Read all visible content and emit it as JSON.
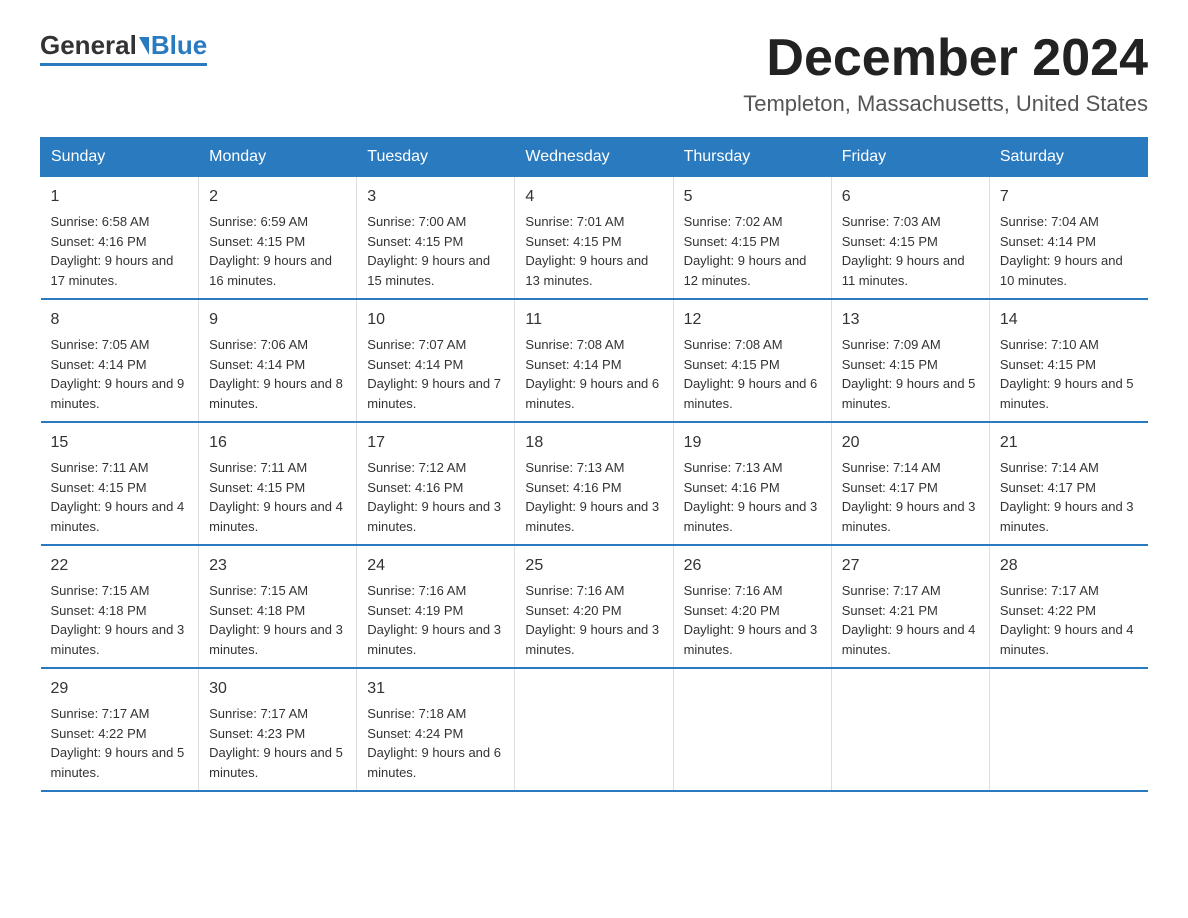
{
  "logo": {
    "general": "General",
    "blue": "Blue"
  },
  "title": "December 2024",
  "subtitle": "Templeton, Massachusetts, United States",
  "headers": [
    "Sunday",
    "Monday",
    "Tuesday",
    "Wednesday",
    "Thursday",
    "Friday",
    "Saturday"
  ],
  "weeks": [
    [
      {
        "day": "1",
        "sunrise": "6:58 AM",
        "sunset": "4:16 PM",
        "daylight": "9 hours and 17 minutes."
      },
      {
        "day": "2",
        "sunrise": "6:59 AM",
        "sunset": "4:15 PM",
        "daylight": "9 hours and 16 minutes."
      },
      {
        "day": "3",
        "sunrise": "7:00 AM",
        "sunset": "4:15 PM",
        "daylight": "9 hours and 15 minutes."
      },
      {
        "day": "4",
        "sunrise": "7:01 AM",
        "sunset": "4:15 PM",
        "daylight": "9 hours and 13 minutes."
      },
      {
        "day": "5",
        "sunrise": "7:02 AM",
        "sunset": "4:15 PM",
        "daylight": "9 hours and 12 minutes."
      },
      {
        "day": "6",
        "sunrise": "7:03 AM",
        "sunset": "4:15 PM",
        "daylight": "9 hours and 11 minutes."
      },
      {
        "day": "7",
        "sunrise": "7:04 AM",
        "sunset": "4:14 PM",
        "daylight": "9 hours and 10 minutes."
      }
    ],
    [
      {
        "day": "8",
        "sunrise": "7:05 AM",
        "sunset": "4:14 PM",
        "daylight": "9 hours and 9 minutes."
      },
      {
        "day": "9",
        "sunrise": "7:06 AM",
        "sunset": "4:14 PM",
        "daylight": "9 hours and 8 minutes."
      },
      {
        "day": "10",
        "sunrise": "7:07 AM",
        "sunset": "4:14 PM",
        "daylight": "9 hours and 7 minutes."
      },
      {
        "day": "11",
        "sunrise": "7:08 AM",
        "sunset": "4:14 PM",
        "daylight": "9 hours and 6 minutes."
      },
      {
        "day": "12",
        "sunrise": "7:08 AM",
        "sunset": "4:15 PM",
        "daylight": "9 hours and 6 minutes."
      },
      {
        "day": "13",
        "sunrise": "7:09 AM",
        "sunset": "4:15 PM",
        "daylight": "9 hours and 5 minutes."
      },
      {
        "day": "14",
        "sunrise": "7:10 AM",
        "sunset": "4:15 PM",
        "daylight": "9 hours and 5 minutes."
      }
    ],
    [
      {
        "day": "15",
        "sunrise": "7:11 AM",
        "sunset": "4:15 PM",
        "daylight": "9 hours and 4 minutes."
      },
      {
        "day": "16",
        "sunrise": "7:11 AM",
        "sunset": "4:15 PM",
        "daylight": "9 hours and 4 minutes."
      },
      {
        "day": "17",
        "sunrise": "7:12 AM",
        "sunset": "4:16 PM",
        "daylight": "9 hours and 3 minutes."
      },
      {
        "day": "18",
        "sunrise": "7:13 AM",
        "sunset": "4:16 PM",
        "daylight": "9 hours and 3 minutes."
      },
      {
        "day": "19",
        "sunrise": "7:13 AM",
        "sunset": "4:16 PM",
        "daylight": "9 hours and 3 minutes."
      },
      {
        "day": "20",
        "sunrise": "7:14 AM",
        "sunset": "4:17 PM",
        "daylight": "9 hours and 3 minutes."
      },
      {
        "day": "21",
        "sunrise": "7:14 AM",
        "sunset": "4:17 PM",
        "daylight": "9 hours and 3 minutes."
      }
    ],
    [
      {
        "day": "22",
        "sunrise": "7:15 AM",
        "sunset": "4:18 PM",
        "daylight": "9 hours and 3 minutes."
      },
      {
        "day": "23",
        "sunrise": "7:15 AM",
        "sunset": "4:18 PM",
        "daylight": "9 hours and 3 minutes."
      },
      {
        "day": "24",
        "sunrise": "7:16 AM",
        "sunset": "4:19 PM",
        "daylight": "9 hours and 3 minutes."
      },
      {
        "day": "25",
        "sunrise": "7:16 AM",
        "sunset": "4:20 PM",
        "daylight": "9 hours and 3 minutes."
      },
      {
        "day": "26",
        "sunrise": "7:16 AM",
        "sunset": "4:20 PM",
        "daylight": "9 hours and 3 minutes."
      },
      {
        "day": "27",
        "sunrise": "7:17 AM",
        "sunset": "4:21 PM",
        "daylight": "9 hours and 4 minutes."
      },
      {
        "day": "28",
        "sunrise": "7:17 AM",
        "sunset": "4:22 PM",
        "daylight": "9 hours and 4 minutes."
      }
    ],
    [
      {
        "day": "29",
        "sunrise": "7:17 AM",
        "sunset": "4:22 PM",
        "daylight": "9 hours and 5 minutes."
      },
      {
        "day": "30",
        "sunrise": "7:17 AM",
        "sunset": "4:23 PM",
        "daylight": "9 hours and 5 minutes."
      },
      {
        "day": "31",
        "sunrise": "7:18 AM",
        "sunset": "4:24 PM",
        "daylight": "9 hours and 6 minutes."
      },
      null,
      null,
      null,
      null
    ]
  ]
}
